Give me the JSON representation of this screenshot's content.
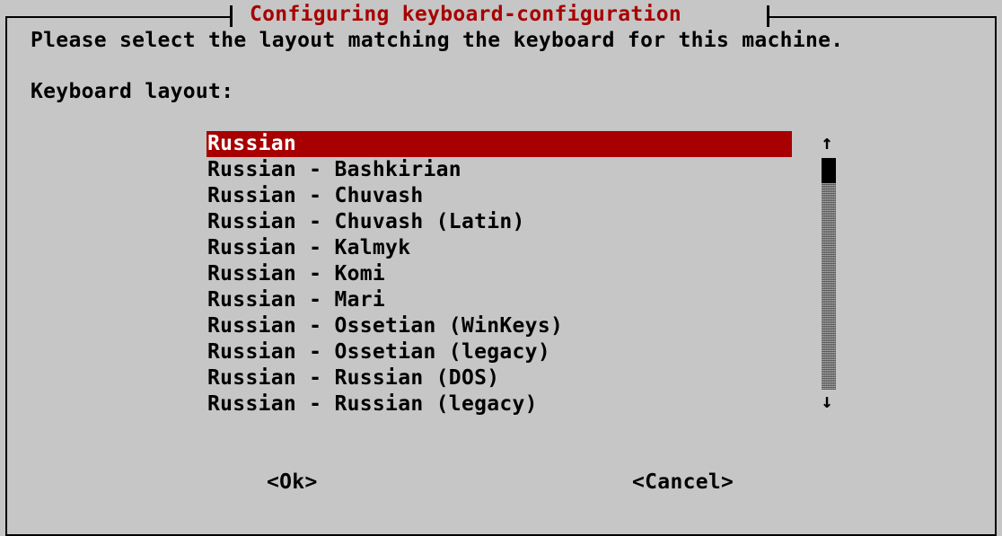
{
  "dialog": {
    "title": "Configuring keyboard-configuration",
    "prompt": "Please select the layout matching the keyboard for this machine.",
    "field_label": "Keyboard layout:"
  },
  "layout_list": {
    "items": [
      {
        "label": "Russian",
        "selected": true
      },
      {
        "label": "Russian - Bashkirian",
        "selected": false
      },
      {
        "label": "Russian - Chuvash",
        "selected": false
      },
      {
        "label": "Russian - Chuvash (Latin)",
        "selected": false
      },
      {
        "label": "Russian - Kalmyk",
        "selected": false
      },
      {
        "label": "Russian - Komi",
        "selected": false
      },
      {
        "label": "Russian - Mari",
        "selected": false
      },
      {
        "label": "Russian - Ossetian (WinKeys)",
        "selected": false
      },
      {
        "label": "Russian - Ossetian (legacy)",
        "selected": false
      },
      {
        "label": "Russian - Russian (DOS)",
        "selected": false
      },
      {
        "label": "Russian - Russian (legacy)",
        "selected": false
      }
    ]
  },
  "scrollbar": {
    "up_arrow": "↑",
    "down_arrow": "↓"
  },
  "buttons": {
    "ok_label": "<Ok>",
    "cancel_label": "<Cancel>"
  },
  "colors": {
    "background": "#c6c6c6",
    "highlight": "#a80000",
    "highlight_text": "#ffffff",
    "title_text": "#a80000"
  }
}
